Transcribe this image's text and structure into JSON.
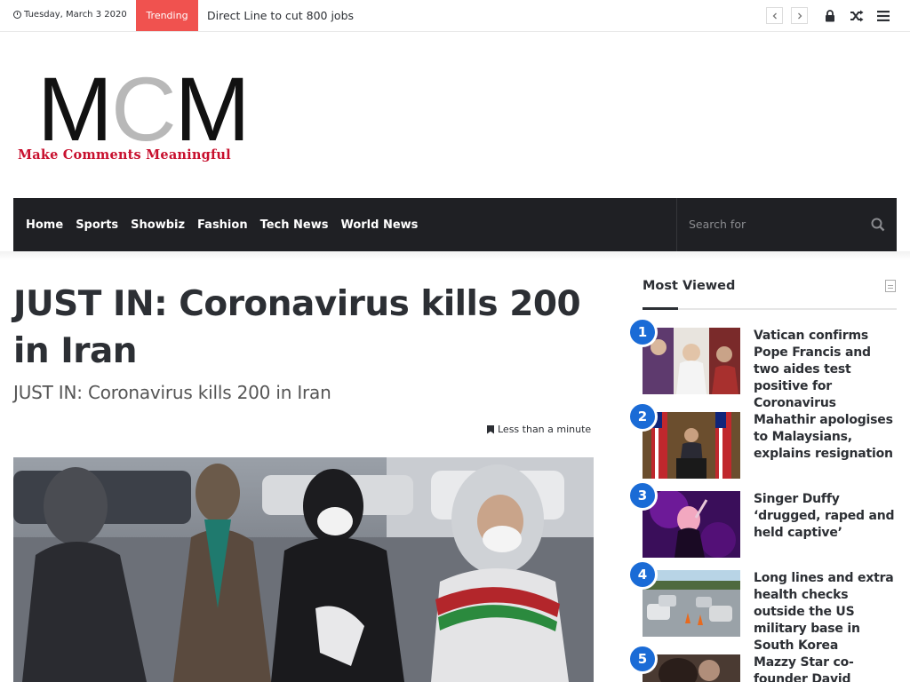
{
  "topbar": {
    "date": "Tuesday, March 3 2020",
    "trending_label": "Trending",
    "headline": "Direct Line to cut 800 jobs",
    "prev_icon": "chevron-left-icon",
    "next_icon": "chevron-right-icon",
    "lock_icon": "lock-icon",
    "random_icon": "shuffle-icon",
    "menu_icon": "menu-icon"
  },
  "logo": {
    "letter1": "M",
    "letter2": "C",
    "letter3": "M",
    "tagline": "Make Comments Meaningful"
  },
  "nav": {
    "items": [
      "Home",
      "Sports",
      "Showbiz",
      "Fashion",
      "Tech News",
      "World News"
    ],
    "search_placeholder": "Search for"
  },
  "article": {
    "title": "JUST IN: Coronavirus kills 200 in Iran",
    "subtitle": "JUST IN: Coronavirus kills 200 in Iran",
    "reading_time": "Less than a minute"
  },
  "sidebar": {
    "title": "Most Viewed",
    "items": [
      {
        "rank": "1",
        "title": "Vatican confirms Pope Francis and two aides test positive for Coronavirus"
      },
      {
        "rank": "2",
        "title": "Mahathir apologises to Malaysians, explains resignation"
      },
      {
        "rank": "3",
        "title": "Singer Duffy ‘drugged, raped and held captive’"
      },
      {
        "rank": "4",
        "title": "Long lines and extra health checks outside the US military base in South Korea"
      },
      {
        "rank": "5",
        "title": "Mazzy Star co-founder David Roback dies"
      }
    ]
  },
  "colors": {
    "trending": "#f0524f",
    "nav_bg": "#1f2024",
    "badge": "#1a6bd6",
    "logo_tagline": "#c8102e"
  }
}
